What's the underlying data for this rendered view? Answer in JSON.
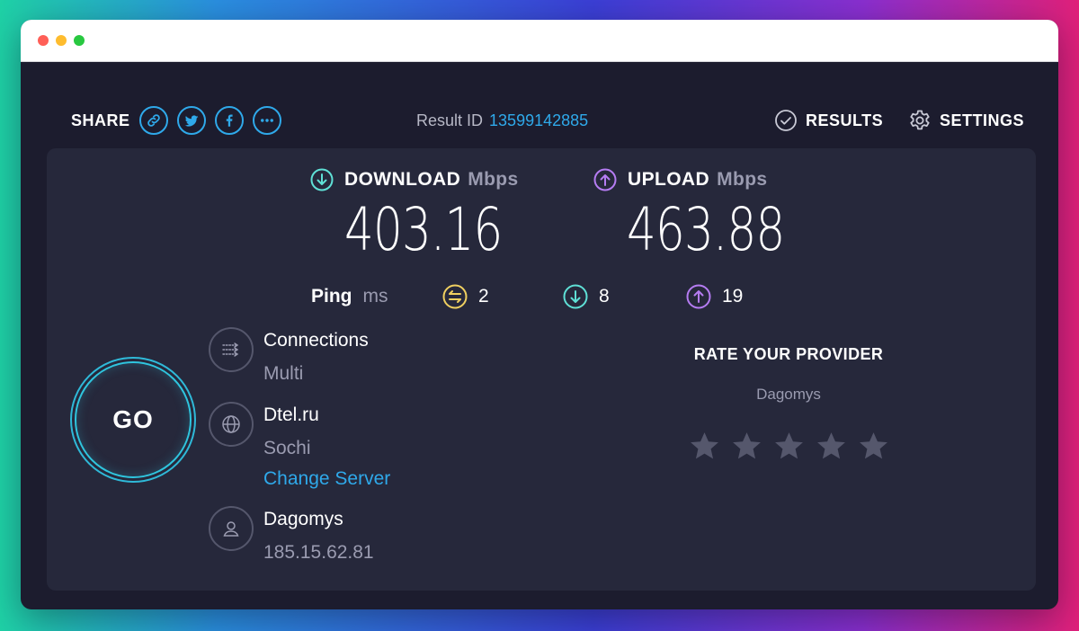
{
  "window": {
    "title_controls": [
      "close",
      "minimize",
      "zoom"
    ]
  },
  "share": {
    "label": "SHARE",
    "buttons": [
      {
        "icon": "link-icon"
      },
      {
        "icon": "twitter-icon"
      },
      {
        "icon": "facebook-icon"
      },
      {
        "icon": "more-icon"
      }
    ]
  },
  "result": {
    "label": "Result ID",
    "id": "13599142885"
  },
  "nav": {
    "results": "RESULTS",
    "settings": "SETTINGS"
  },
  "download": {
    "label": "DOWNLOAD",
    "unit": "Mbps",
    "value": "403.16"
  },
  "upload": {
    "label": "UPLOAD",
    "unit": "Mbps",
    "value": "463.88"
  },
  "ping": {
    "label": "Ping",
    "unit": "ms",
    "jitter": "2",
    "download": "8",
    "upload": "19"
  },
  "go": {
    "label": "GO"
  },
  "connections": {
    "title": "Connections",
    "value": "Multi"
  },
  "server": {
    "name": "Dtel.ru",
    "location": "Sochi",
    "change_label": "Change Server"
  },
  "user": {
    "provider": "Dagomys",
    "ip": "185.15.62.81"
  },
  "rate": {
    "title": "RATE YOUR PROVIDER",
    "provider": "Dagomys",
    "stars": 5,
    "rating": 0
  },
  "colors": {
    "accent": "#2fa9ea",
    "download": "#5fe0d6",
    "upload": "#b57cf2",
    "jitter": "#f0d060",
    "panel": "#26283b",
    "background": "#1c1c2e"
  }
}
